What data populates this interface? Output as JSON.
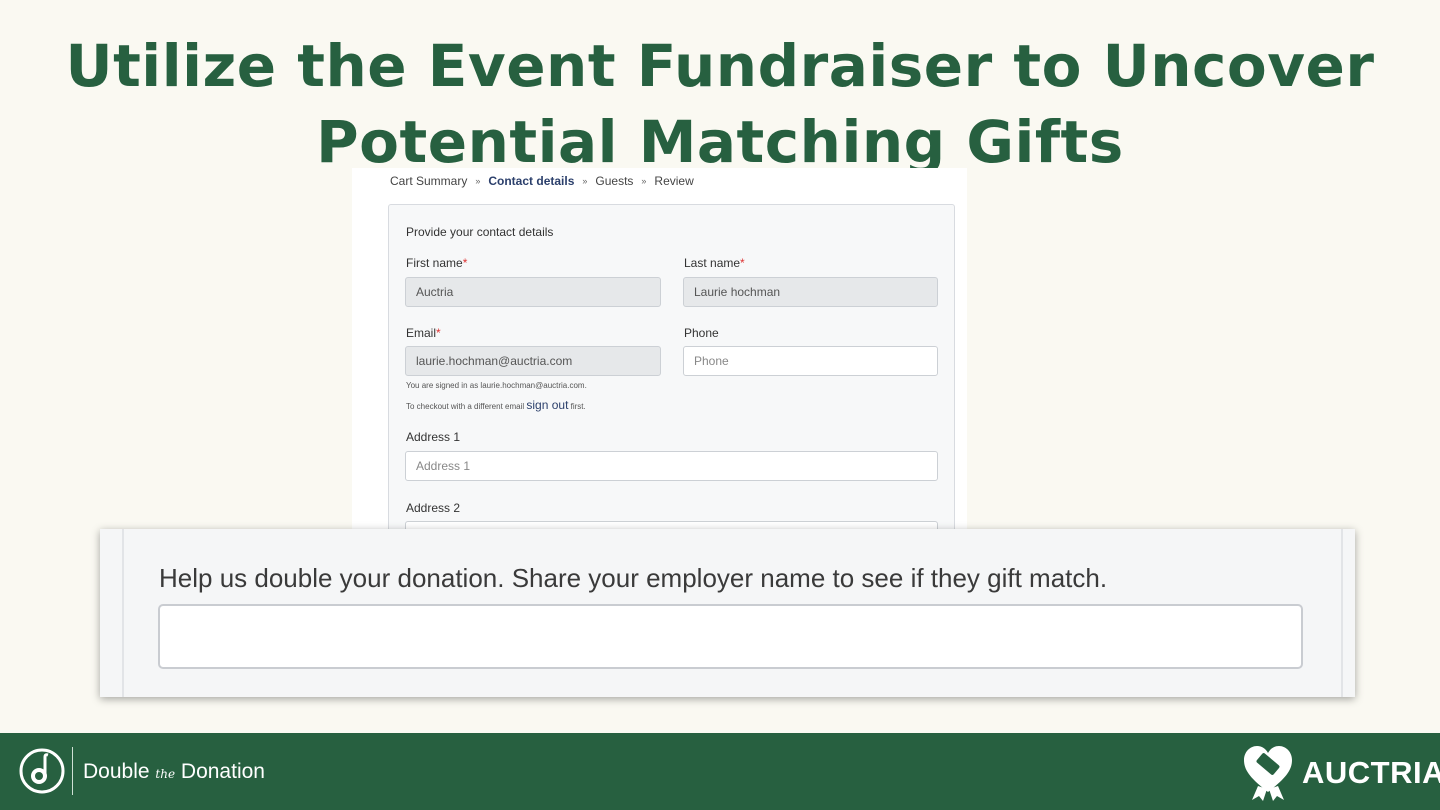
{
  "slide": {
    "title_line1": "Utilize the Event Fundraiser to Uncover",
    "title_line2": "Potential Matching Gifts"
  },
  "breadcrumb": {
    "steps": [
      "Cart Summary",
      "Contact details",
      "Guests",
      "Review"
    ],
    "separator": "»",
    "active_index": 1
  },
  "form": {
    "heading": "Provide your contact details",
    "required_marker": "*",
    "first_name": {
      "label": "First name",
      "value": "Auctria"
    },
    "last_name": {
      "label": "Last name",
      "value": "Laurie hochman"
    },
    "email": {
      "label": "Email",
      "value": "laurie.hochman@auctria.com"
    },
    "phone": {
      "label": "Phone",
      "placeholder": "Phone"
    },
    "signed_in_note": "You are signed in as laurie.hochman@auctria.com.",
    "checkout_note_prefix": "To checkout with a different email",
    "sign_out_link": "sign out",
    "checkout_note_suffix": "first.",
    "address1": {
      "label": "Address 1",
      "placeholder": "Address 1"
    },
    "address2": {
      "label": "Address 2"
    }
  },
  "match_widget": {
    "label": "Help us double your donation. Share your employer name to see if they gift match.",
    "value": ""
  },
  "footer": {
    "left_brand_1": "Double",
    "left_brand_the": "the",
    "left_brand_2": "Donation",
    "right_brand": "AUCTRIA",
    "background_color": "#276040"
  },
  "colors": {
    "title": "#276040",
    "background": "#faf9f2",
    "required": "#dd3333",
    "active_step": "#2b3f6b"
  },
  "icons": [
    "double-the-donation-logo-icon",
    "auctria-heart-ribbon-logo-icon"
  ]
}
